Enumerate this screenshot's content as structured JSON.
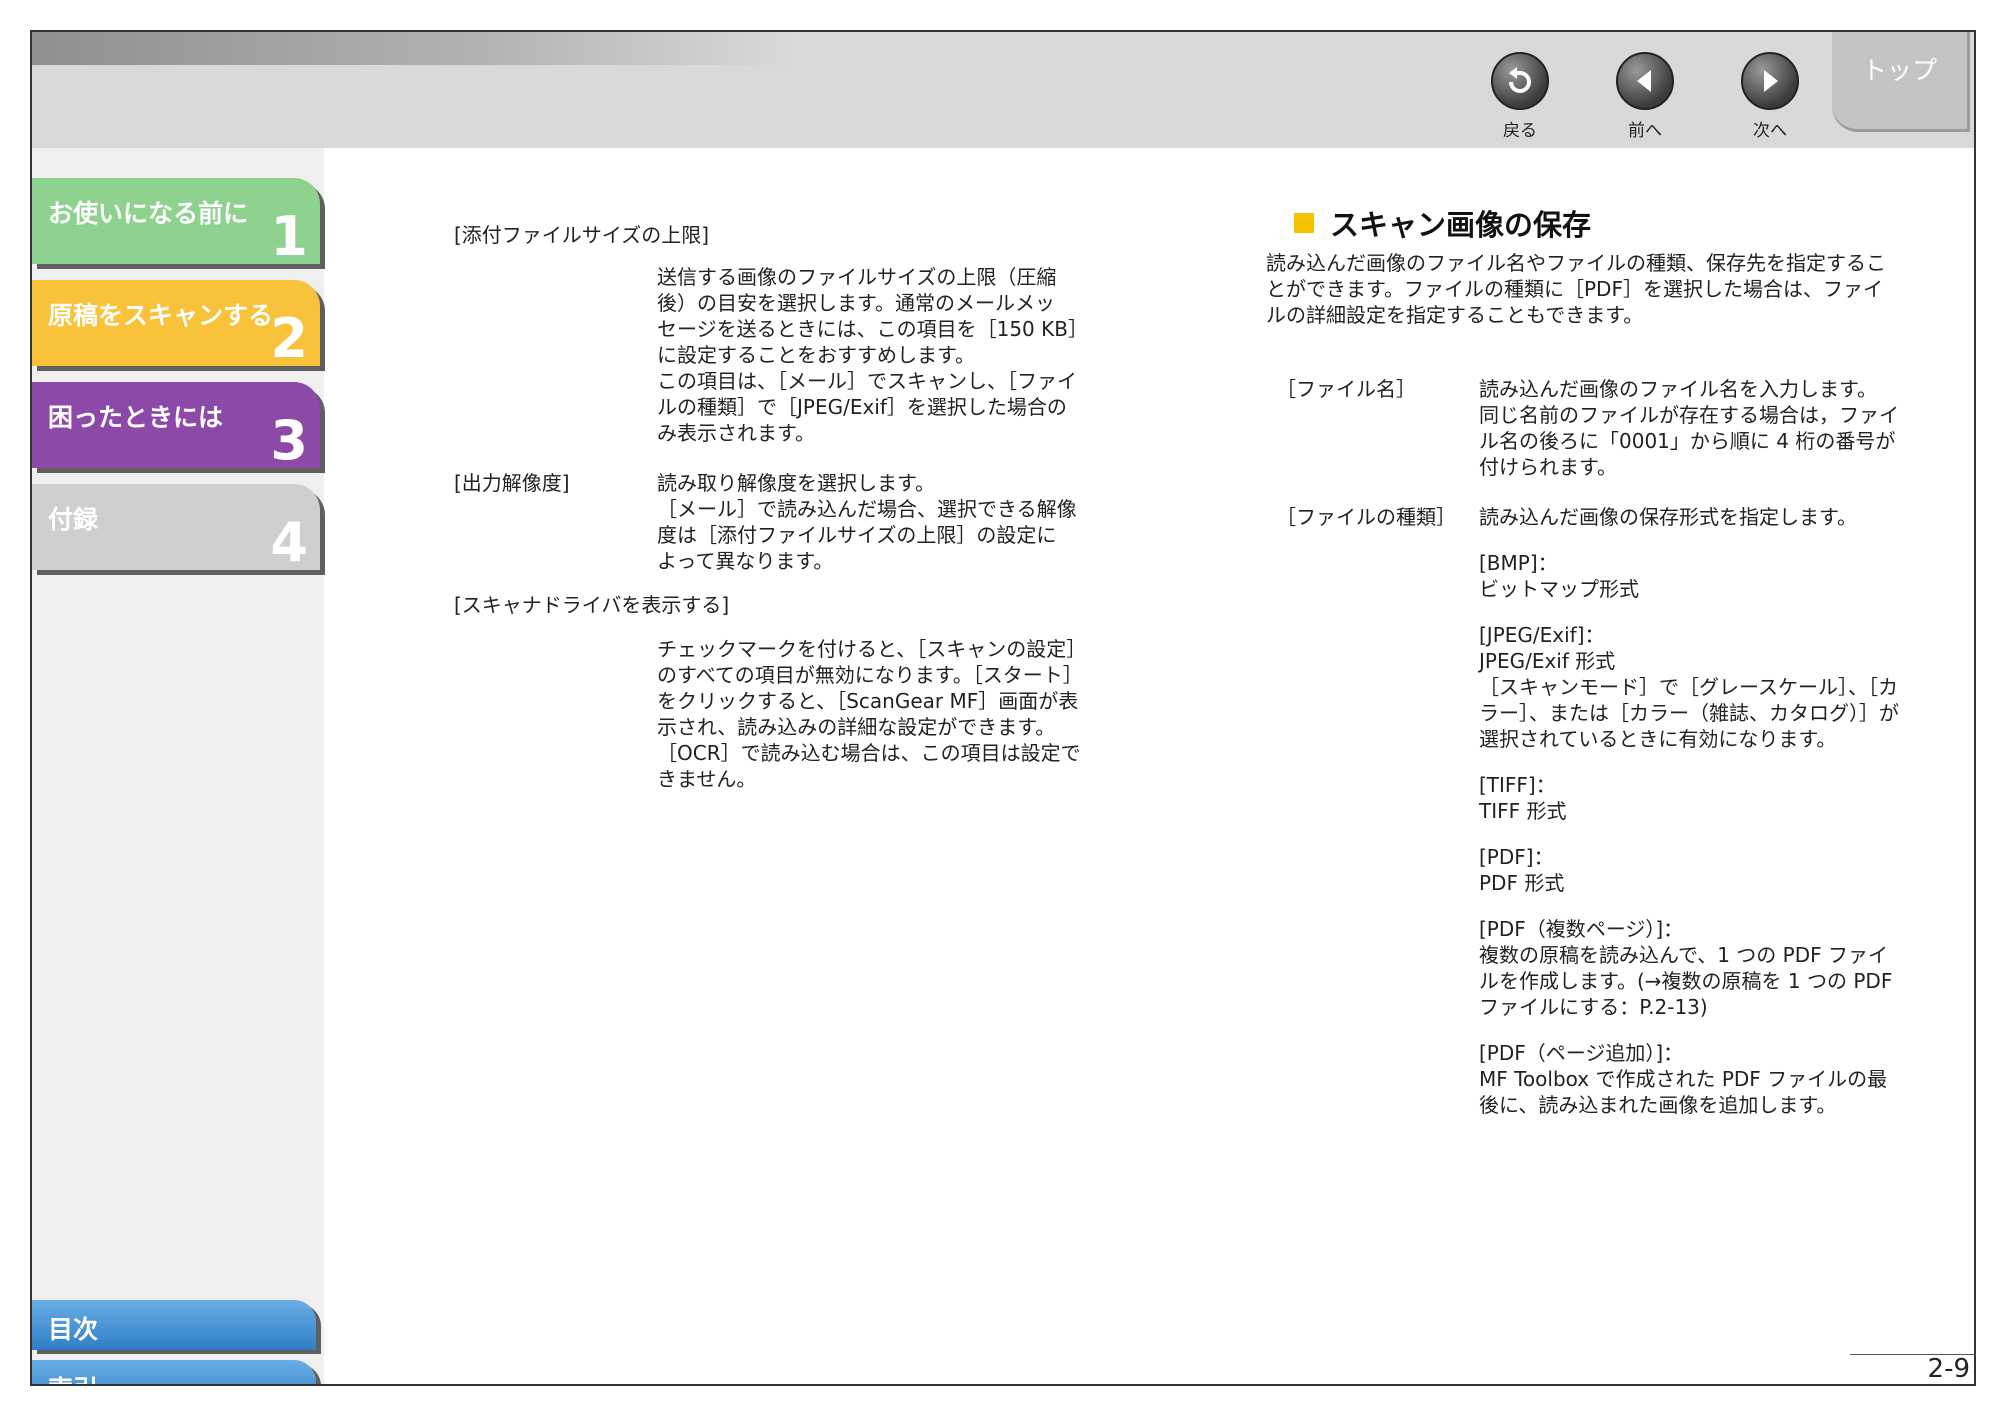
{
  "nav": {
    "back": "戻る",
    "prev": "前へ",
    "next": "次へ",
    "top": "トップ"
  },
  "chapters": [
    {
      "label": "お使いになる前に",
      "num": "1",
      "color": "#8fd18f"
    },
    {
      "label": "原稿をスキャンする",
      "num": "2",
      "color": "#f8c23a"
    },
    {
      "label": "困ったときには",
      "num": "3",
      "color": "#8d49a8"
    },
    {
      "label": "付録",
      "num": "4",
      "color": "#cfcfcf"
    }
  ],
  "bottom": {
    "toc": "目次",
    "index": "索引"
  },
  "left": {
    "item1_term": "[添付ファイルサイズの上限]",
    "item1_desc": [
      "送信する画像のファイルサイズの上限（圧縮",
      "後）の目安を選択します。通常のメールメッ",
      "セージを送るときには、この項目を［150 KB］",
      "に設定することをおすすめします。",
      "この項目は、［メール］でスキャンし、［ファイ",
      "ルの種類］で［JPEG/Exif］を選択した場合の",
      "み表示されます。"
    ],
    "item2_term": "[出力解像度]",
    "item2_desc": [
      "読み取り解像度を選択します。",
      "［メール］で読み込んだ場合、選択できる解像",
      "度は［添付ファイルサイズの上限］の設定に",
      "よって異なります。"
    ],
    "item3_term": "[スキャナドライバを表示する]",
    "item3_desc": [
      "チェックマークを付けると、［スキャンの設定］",
      "のすべての項目が無効になります。［スタート］",
      "をクリックすると、［ScanGear MF］画面が表",
      "示され、読み込みの詳細な設定ができます。",
      "［OCR］で読み込む場合は、この項目は設定で",
      "きません。"
    ]
  },
  "right": {
    "title": "スキャン画像の保存",
    "intro": [
      "読み込んだ画像のファイル名やファイルの種類、保存先を指定するこ",
      "とができます。ファイルの種類に［PDF］を選択した場合は、ファイ",
      "ルの詳細設定を指定することもできます。"
    ],
    "fn_term": "［ファイル名］",
    "fn_desc": [
      "読み込んだ画像のファイル名を入力します。",
      "同じ名前のファイルが存在する場合は，ファイ",
      "ル名の後ろに「0001」から順に 4 桁の番号が",
      "付けられます。"
    ],
    "ft_term": "［ファイルの種類］",
    "ft_desc": "読み込んだ画像の保存形式を指定します。",
    "bmp": [
      "[BMP]：",
      "ビットマップ形式"
    ],
    "jpeg": [
      "[JPEG/Exif]：",
      "JPEG/Exif 形式",
      "［スキャンモード］で［グレースケール］、［カ",
      "ラー］、または［カラー（雑誌、カタログ）］が",
      "選択されているときに有効になります。"
    ],
    "tiff": [
      "[TIFF]：",
      "TIFF 形式"
    ],
    "pdf": [
      "[PDF]：",
      "PDF 形式"
    ],
    "pdfm": [
      "[PDF（複数ページ）]：",
      "複数の原稿を読み込んで、1 つの PDF ファイ",
      "ルを作成します。(→複数の原稿を 1 つの PDF",
      "ファイルにする：P.2-13)"
    ],
    "pdfa": [
      "[PDF（ページ追加）]：",
      "MF Toolbox で作成された PDF ファイルの最",
      "後に、読み込まれた画像を追加します。"
    ]
  },
  "page_number": "2-9"
}
